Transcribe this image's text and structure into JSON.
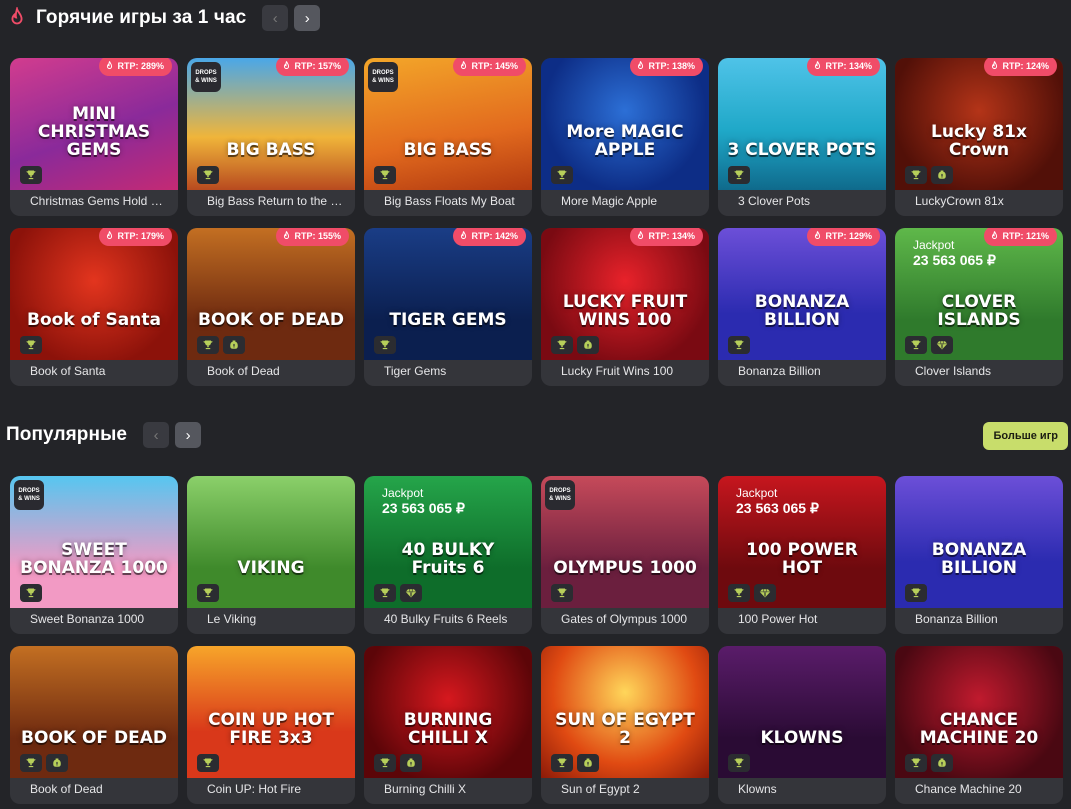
{
  "hot_section": {
    "title": "Горячие игры за 1 час",
    "games": [
      {
        "name": "Christmas Gems Hold …",
        "logo": "MINI CHRISTMAS GEMS",
        "rtp": "RTP: 289%",
        "tags": [
          "trophy"
        ],
        "bg": "linear-gradient(160deg,#d23c8e,#8a2a9a 55%,#c42a74)",
        "drops": false,
        "jackpot": null
      },
      {
        "name": "Big Bass Return to the …",
        "logo": "BIG BASS",
        "rtp": "RTP: 157%",
        "tags": [
          "trophy"
        ],
        "bg": "linear-gradient(180deg,#4aa7e8,#f0b53a 60%,#b84a1f)",
        "drops": true,
        "jackpot": null
      },
      {
        "name": "Big Bass Floats My Boat",
        "logo": "BIG BASS",
        "rtp": "RTP: 145%",
        "tags": [
          "trophy"
        ],
        "bg": "linear-gradient(170deg,#f3a629,#e26a1e 60%,#b23a10)",
        "drops": true,
        "jackpot": null
      },
      {
        "name": "More Magic Apple",
        "logo": "More MAGIC APPLE",
        "rtp": "RTP: 138%",
        "tags": [
          "trophy"
        ],
        "bg": "radial-gradient(circle at 50% 40%,#2c6fd6,#0d2d86 70%)",
        "drops": false,
        "jackpot": null
      },
      {
        "name": "3 Clover Pots",
        "logo": "3 CLOVER POTS",
        "rtp": "RTP: 134%",
        "tags": [
          "trophy"
        ],
        "bg": "linear-gradient(180deg,#4fc3e8,#1fa8c8 55%,#0f6a8c)",
        "drops": false,
        "jackpot": null
      },
      {
        "name": "LuckyCrown 81x",
        "logo": "Lucky 81x Crown",
        "rtp": "RTP: 124%",
        "tags": [
          "trophy",
          "bag"
        ],
        "bg": "radial-gradient(circle at 50% 40%,#b43418,#521008 75%)",
        "drops": false,
        "jackpot": null
      },
      {
        "name": "Book of Santa",
        "logo": "Book of Santa",
        "rtp": "RTP: 179%",
        "tags": [
          "trophy"
        ],
        "bg": "radial-gradient(circle at 50% 40%,#e3351e,#8c120a 75%)",
        "drops": false,
        "jackpot": null
      },
      {
        "name": "Book of Dead",
        "logo": "BOOK OF DEAD",
        "rtp": "RTP: 155%",
        "tags": [
          "trophy",
          "bag"
        ],
        "bg": "linear-gradient(180deg,#c36f22,#6e2a10 70%)",
        "drops": false,
        "jackpot": null
      },
      {
        "name": "Tiger Gems",
        "logo": "TIGER GEMS",
        "rtp": "RTP: 142%",
        "tags": [
          "trophy"
        ],
        "bg": "linear-gradient(180deg,#1a3d86,#0b1f4f 70%)",
        "drops": false,
        "jackpot": null
      },
      {
        "name": "Lucky Fruit Wins 100",
        "logo": "LUCKY FRUIT WINS 100",
        "rtp": "RTP: 134%",
        "tags": [
          "trophy",
          "bag"
        ],
        "bg": "radial-gradient(circle at 50% 40%,#e8222a,#7a0a12 75%)",
        "drops": false,
        "jackpot": null
      },
      {
        "name": "Bonanza Billion",
        "logo": "BONANZA BILLION",
        "rtp": "RTP: 129%",
        "tags": [
          "trophy"
        ],
        "bg": "linear-gradient(180deg,#6c4fd8,#2b2bb0 65%)",
        "drops": false,
        "jackpot": null
      },
      {
        "name": "Clover Islands",
        "logo": "CLOVER ISLANDS",
        "rtp": "RTP: 121%",
        "tags": [
          "trophy",
          "gem"
        ],
        "bg": "linear-gradient(180deg,#5fb84a,#2f7a2c 70%)",
        "drops": false,
        "jackpot": {
          "label": "Jackpot",
          "amount": "23 563 065 ₽"
        }
      }
    ]
  },
  "popular_section": {
    "title": "Популярные",
    "more_label": "Больше игр",
    "games": [
      {
        "name": "Sweet Bonanza 1000",
        "logo": "SWEET BONANZA 1000",
        "tags": [
          "trophy"
        ],
        "bg": "linear-gradient(180deg,#56c6f0,#f29ac4 70%)",
        "drops": true,
        "jackpot": null
      },
      {
        "name": "Le Viking",
        "logo": "VIKING",
        "tags": [
          "trophy"
        ],
        "bg": "linear-gradient(180deg,#8bd06a,#3f8a2b 70%)",
        "drops": false,
        "jackpot": null
      },
      {
        "name": "40 Bulky Fruits 6 Reels",
        "logo": "40 BULKY Fruits 6",
        "tags": [
          "trophy",
          "gem"
        ],
        "bg": "linear-gradient(180deg,#25a54a,#0e6d2a 70%)",
        "drops": false,
        "jackpot": {
          "label": "Jackpot",
          "amount": "23 563 065 ₽"
        }
      },
      {
        "name": "Gates of Olympus 1000",
        "logo": "OLYMPUS 1000",
        "tags": [
          "trophy"
        ],
        "bg": "linear-gradient(180deg,#c64a5a,#6b1f3e 70%)",
        "drops": true,
        "jackpot": null
      },
      {
        "name": "100 Power Hot",
        "logo": "100 POWER HOT",
        "tags": [
          "trophy",
          "gem"
        ],
        "bg": "linear-gradient(180deg,#c6161e,#6e0a0e 70%)",
        "drops": false,
        "jackpot": {
          "label": "Jackpot",
          "amount": "23 563 065 ₽"
        }
      },
      {
        "name": "Bonanza Billion",
        "logo": "BONANZA BILLION",
        "tags": [
          "trophy"
        ],
        "bg": "linear-gradient(180deg,#6c4fd8,#2b2bb0 65%)",
        "drops": false,
        "jackpot": null
      },
      {
        "name": "Book of Dead",
        "logo": "BOOK OF DEAD",
        "tags": [
          "trophy",
          "bag"
        ],
        "bg": "linear-gradient(180deg,#c36f22,#6e2a10 70%)",
        "drops": false,
        "jackpot": null
      },
      {
        "name": "Coin UP: Hot Fire",
        "logo": "COIN UP HOT FIRE 3x3",
        "tags": [
          "trophy"
        ],
        "bg": "linear-gradient(180deg,#f7a52a,#d9381a 65%)",
        "drops": false,
        "jackpot": null
      },
      {
        "name": "Burning Chilli X",
        "logo": "BURNING CHILLI X",
        "tags": [
          "trophy",
          "bag"
        ],
        "bg": "radial-gradient(circle at 50% 40%,#d6181e,#5c0508 75%)",
        "drops": false,
        "jackpot": null
      },
      {
        "name": "Sun of Egypt 2",
        "logo": "SUN OF EGYPT 2",
        "tags": [
          "trophy",
          "bag"
        ],
        "bg": "radial-gradient(circle at 50% 35%,#ffd65a,#e04a12 60%,#8c1a08)",
        "drops": false,
        "jackpot": null
      },
      {
        "name": "Klowns",
        "logo": "KLOWNS",
        "tags": [
          "trophy"
        ],
        "bg": "linear-gradient(180deg,#5a1c6a,#2a0b34 70%)",
        "drops": false,
        "jackpot": null
      },
      {
        "name": "Chance Machine 20",
        "logo": "CHANCE MACHINE 20",
        "tags": [
          "trophy",
          "bag"
        ],
        "bg": "radial-gradient(circle at 50% 40%,#c01a2e,#4a0812 75%)",
        "drops": false,
        "jackpot": null
      }
    ]
  },
  "drops_badge_text": "DROPS & WINS",
  "colors": {
    "page_bg": "#232428",
    "card_bg": "#34353a",
    "rtp_badge": "#f04c68",
    "more_button": "#c8dd6b",
    "icon_green": "#b7cf5a"
  }
}
